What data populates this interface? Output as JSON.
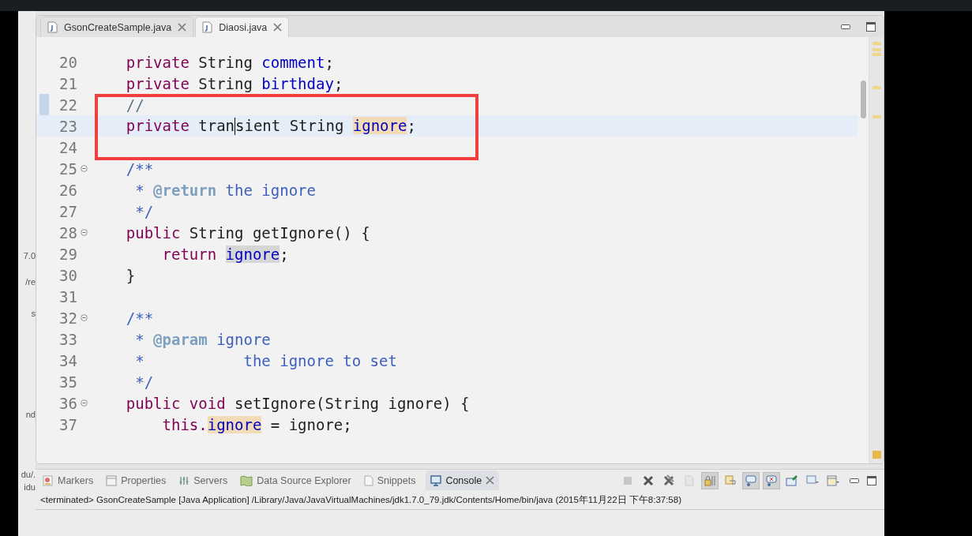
{
  "side_panel": {
    "fragments": [
      "7.0",
      "/re",
      "s",
      "nd",
      "du/.",
      "idu"
    ]
  },
  "editor": {
    "tabs": [
      {
        "label": "GsonCreateSample.java",
        "selected": false
      },
      {
        "label": "Diaosi.java",
        "selected": true
      }
    ],
    "lines": [
      {
        "number": "20",
        "fold": false,
        "current": false,
        "changed": false,
        "tokens": [
          {
            "text": "    private",
            "kind": "keyword"
          },
          {
            "text": " String ",
            "kind": "plain"
          },
          {
            "text": "comment",
            "kind": "field"
          },
          {
            "text": ";",
            "kind": "plain"
          }
        ]
      },
      {
        "number": "21",
        "fold": false,
        "current": false,
        "changed": false,
        "tokens": [
          {
            "text": "    private",
            "kind": "keyword"
          },
          {
            "text": " String ",
            "kind": "plain"
          },
          {
            "text": "birthday",
            "kind": "field"
          },
          {
            "text": ";",
            "kind": "plain"
          }
        ]
      },
      {
        "number": "22",
        "fold": false,
        "current": false,
        "changed": true,
        "tokens": [
          {
            "text": "    //",
            "kind": "comment"
          }
        ]
      },
      {
        "number": "23",
        "fold": false,
        "current": true,
        "changed": false,
        "tokens": [
          {
            "text": "    private",
            "kind": "keyword"
          },
          {
            "text": " tran",
            "kind": "plain",
            "caret_after": true
          },
          {
            "text": "sient String ",
            "kind": "plain"
          },
          {
            "text": "ignore",
            "kind": "field",
            "occurrence": true,
            "write_access": true
          },
          {
            "text": ";",
            "kind": "plain"
          }
        ]
      },
      {
        "number": "24",
        "fold": false,
        "current": false,
        "changed": false
      },
      {
        "number": "25",
        "fold": true,
        "current": false,
        "changed": false,
        "tokens": [
          {
            "text": "    /**",
            "kind": "javadoc"
          }
        ]
      },
      {
        "number": "26",
        "fold": false,
        "current": false,
        "changed": false,
        "tokens": [
          {
            "text": "     * ",
            "kind": "javadoc"
          },
          {
            "text": "@return",
            "kind": "tag"
          },
          {
            "text": " the ignore",
            "kind": "javadoc"
          }
        ]
      },
      {
        "number": "27",
        "fold": false,
        "current": false,
        "changed": false,
        "tokens": [
          {
            "text": "     */",
            "kind": "javadoc"
          }
        ]
      },
      {
        "number": "28",
        "fold": true,
        "current": false,
        "changed": false,
        "tokens": [
          {
            "text": "    public",
            "kind": "keyword"
          },
          {
            "text": " String getIgnore() {",
            "kind": "plain"
          }
        ]
      },
      {
        "number": "29",
        "fold": false,
        "current": false,
        "changed": false,
        "tokens": [
          {
            "text": "        return ",
            "kind": "keyword"
          },
          {
            "text": "ignore",
            "kind": "field",
            "occurrence": true,
            "write_access": false
          },
          {
            "text": ";",
            "kind": "plain"
          }
        ]
      },
      {
        "number": "30",
        "fold": false,
        "current": false,
        "changed": false,
        "tokens": [
          {
            "text": "    }",
            "kind": "plain"
          }
        ]
      },
      {
        "number": "31",
        "fold": false,
        "current": false,
        "changed": false
      },
      {
        "number": "32",
        "fold": true,
        "current": false,
        "changed": false,
        "tokens": [
          {
            "text": "    /**",
            "kind": "javadoc"
          }
        ]
      },
      {
        "number": "33",
        "fold": false,
        "current": false,
        "changed": false,
        "tokens": [
          {
            "text": "     * ",
            "kind": "javadoc"
          },
          {
            "text": "@param",
            "kind": "tag"
          },
          {
            "text": " ignore",
            "kind": "javadoc"
          }
        ]
      },
      {
        "number": "34",
        "fold": false,
        "current": false,
        "changed": false,
        "tokens": [
          {
            "text": "     *           the ignore to set",
            "kind": "javadoc"
          }
        ]
      },
      {
        "number": "35",
        "fold": false,
        "current": false,
        "changed": false,
        "tokens": [
          {
            "text": "     */",
            "kind": "javadoc"
          }
        ]
      },
      {
        "number": "36",
        "fold": true,
        "current": false,
        "changed": false,
        "tokens": [
          {
            "text": "    public void",
            "kind": "keyword"
          },
          {
            "text": " setIgnore(String ignore) {",
            "kind": "plain"
          }
        ]
      },
      {
        "number": "37",
        "fold": false,
        "current": false,
        "changed": false,
        "tokens": [
          {
            "text": "        this.",
            "kind": "keyword"
          },
          {
            "text": "ignore",
            "kind": "field",
            "occurrence": true,
            "write_access": true
          },
          {
            "text": " = ignore;",
            "kind": "plain"
          }
        ]
      }
    ]
  },
  "bottom_panel": {
    "tabs": [
      {
        "label": "Markers",
        "kind": "markers",
        "selected": false
      },
      {
        "label": "Properties",
        "kind": "properties",
        "selected": false
      },
      {
        "label": "Servers",
        "kind": "servers",
        "selected": false
      },
      {
        "label": "Data Source Explorer",
        "kind": "datasource",
        "selected": false
      },
      {
        "label": "Snippets",
        "kind": "snippets",
        "selected": false
      },
      {
        "label": "Console",
        "kind": "console",
        "selected": true
      }
    ],
    "toolbar": [
      {
        "kind": "stop",
        "disabled": true,
        "pressed": false
      },
      {
        "kind": "remove",
        "disabled": false,
        "pressed": false
      },
      {
        "kind": "remove-all",
        "disabled": false,
        "pressed": false
      },
      {
        "kind": "clear",
        "disabled": true,
        "pressed": false
      },
      {
        "kind": "scroll-lock",
        "disabled": false,
        "pressed": true
      },
      {
        "kind": "word-wrap",
        "disabled": false,
        "pressed": false
      },
      {
        "kind": "show-out",
        "disabled": false,
        "pressed": true
      },
      {
        "kind": "show-err",
        "disabled": false,
        "pressed": true
      },
      {
        "kind": "pin",
        "disabled": false,
        "pressed": false
      },
      {
        "kind": "display",
        "disabled": false,
        "pressed": false
      },
      {
        "kind": "open",
        "disabled": false,
        "pressed": false
      }
    ],
    "console_header": "<terminated> GsonCreateSample [Java Application] /Library/Java/JavaVirtualMachines/jdk1.7.0_79.jdk/Contents/Home/bin/java (2015年11月22日 下午8:37:58)"
  }
}
